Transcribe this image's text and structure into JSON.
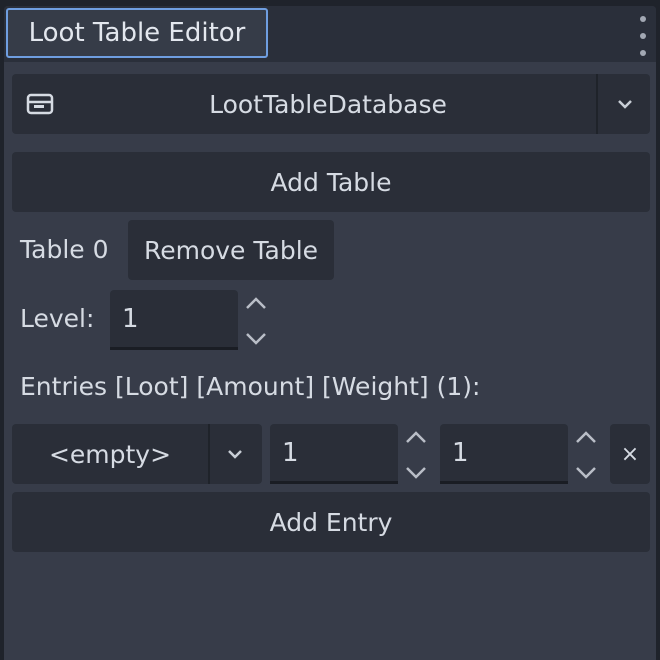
{
  "dock": {
    "tab_title": "Loot Table Editor",
    "menu_icon": "vertical-dots-icon"
  },
  "resource_picker": {
    "icon": "resource-icon",
    "value": "LootTableDatabase",
    "dropdown_icon": "chevron-down-icon"
  },
  "add_table_label": "Add Table",
  "table": {
    "name": "Table 0",
    "remove_label": "Remove Table",
    "level_label": "Level:",
    "level_value": "1"
  },
  "entries": {
    "header": "Entries [Loot] [Amount] [Weight] (1):",
    "rows": [
      {
        "loot": "<empty>",
        "amount": "1",
        "weight": "1",
        "remove_label": "×"
      }
    ],
    "add_entry_label": "Add Entry"
  },
  "colors": {
    "panel_bg": "#373c49",
    "control_bg": "#2a2e38",
    "tab_focus_border": "#6f9ee0",
    "text": "#d6dbe3"
  }
}
